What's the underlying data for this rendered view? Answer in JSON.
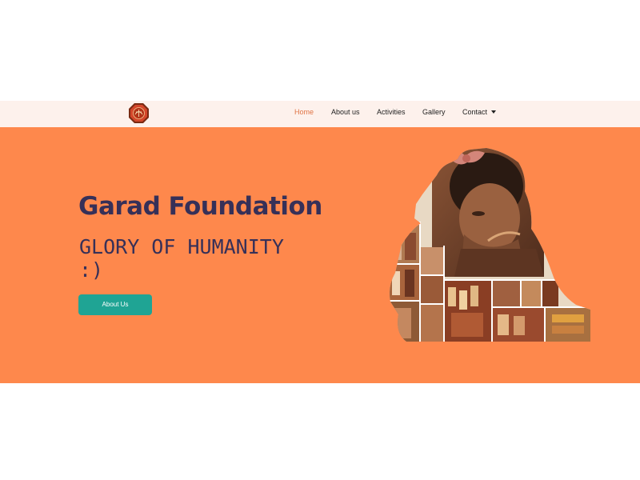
{
  "nav": {
    "logo_icon": "garad-foundation-logo",
    "items": [
      {
        "label": "Home",
        "active": true
      },
      {
        "label": "About us",
        "active": false
      },
      {
        "label": "Activities",
        "active": false
      },
      {
        "label": "Gallery",
        "active": false
      },
      {
        "label": "Contact",
        "active": false,
        "has_dropdown": true
      }
    ]
  },
  "hero": {
    "title": "Garad Foundation",
    "subtitle": "GLORY OF HUMANITY :)",
    "button_label": "About Us",
    "image_icon": "child-photo-collage"
  },
  "colors": {
    "nav_background": "#fdf1ec",
    "nav_active": "#e07445",
    "hero_background": "#fe884c",
    "title_color": "#363058",
    "button_color": "#1fa494"
  }
}
